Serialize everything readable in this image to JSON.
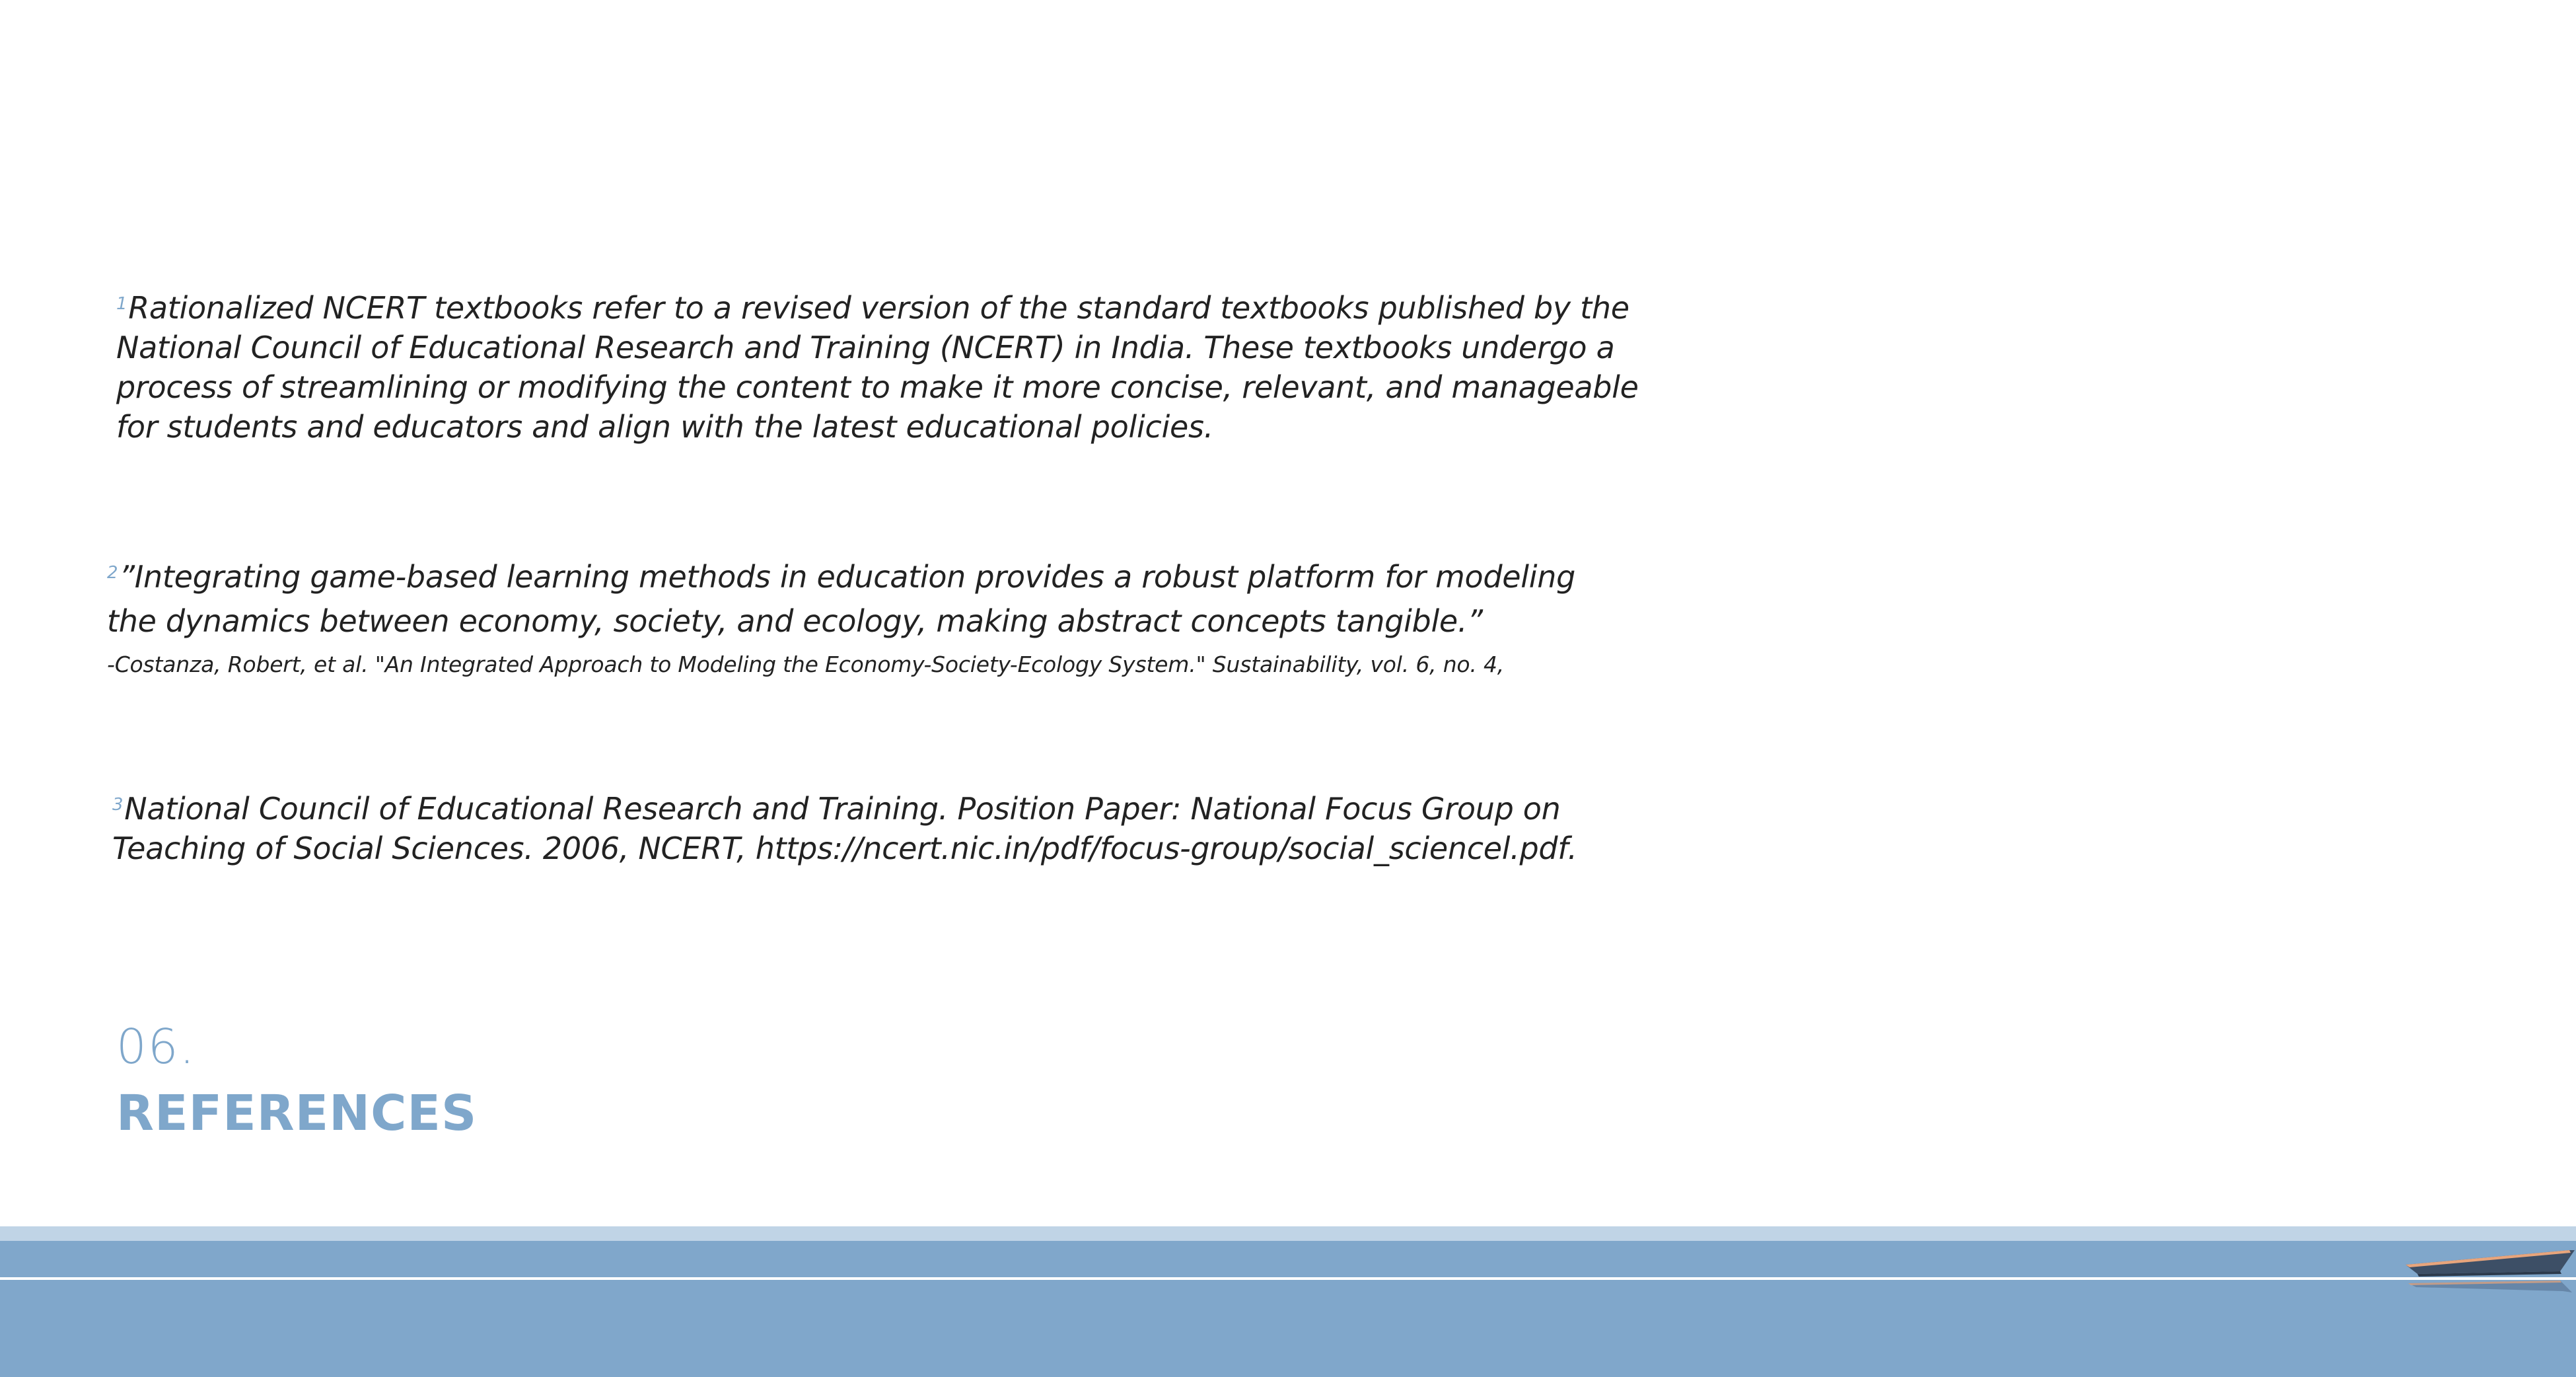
{
  "notes": [
    {
      "marker": "1",
      "lines": [
        "Rationalized NCERT textbooks refer to a revised version of the standard textbooks published by the",
        "National Council of Educational Research and Training (NCERT) in India. These textbooks undergo a",
        "process of streamlining or modifying the content to make it more concise, relevant, and manageable",
        "for students and educators and align with the latest educational policies."
      ]
    },
    {
      "marker": "2",
      "lines": [
        "”Integrating game-based learning methods in education provides a robust platform for modeling",
        "the dynamics between economy, society, and ecology, making abstract concepts tangible.”"
      ],
      "citation": "-Costanza, Robert, et al. \"An Integrated Approach to Modeling the Economy-Society-Ecology System.\" Sustainability, vol. 6, no. 4,"
    },
    {
      "marker": "3",
      "lines": [
        "National Council of Educational Research and Training. Position Paper: National Focus Group on",
        "Teaching of Social Sciences. 2006, NCERT, https://ncert.nic.in/pdf/focus-group/social_sciencel.pdf."
      ]
    }
  ],
  "section": {
    "number": "06.",
    "title": "REFERENCES"
  },
  "colors": {
    "accent": "#7fa7cb",
    "band_light": "#c0d4e6",
    "band_main": "#80a7cb",
    "text": "#222222"
  },
  "decor": {
    "boat_icon": "boat-icon"
  }
}
